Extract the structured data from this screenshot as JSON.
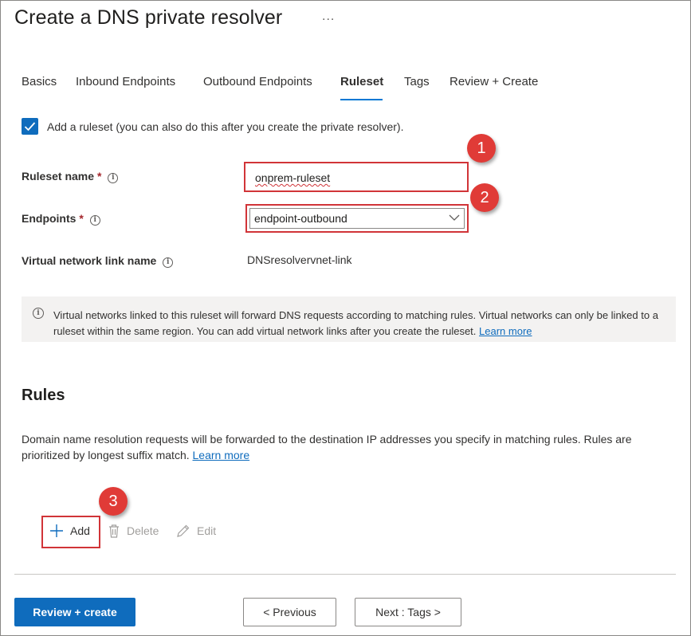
{
  "page": {
    "title": "Create a DNS private resolver",
    "more_label": "..."
  },
  "tabs": [
    {
      "label": "Basics",
      "active": false
    },
    {
      "label": "Inbound Endpoints",
      "active": false
    },
    {
      "label": "Outbound Endpoints",
      "active": false
    },
    {
      "label": "Ruleset",
      "active": true
    },
    {
      "label": "Tags",
      "active": false
    },
    {
      "label": "Review + Create",
      "active": false
    }
  ],
  "ruleset_checkbox": {
    "checked": true,
    "label": "Add a ruleset (you can also do this after you create the private resolver)."
  },
  "form": {
    "ruleset_name": {
      "label": "Ruleset name",
      "required_mark": "*",
      "value": "onprem-ruleset"
    },
    "endpoints": {
      "label": "Endpoints",
      "required_mark": "*",
      "value": "endpoint-outbound"
    },
    "vnet_link": {
      "label": "Virtual network link name",
      "value": "DNSresolvervnet-link"
    }
  },
  "info_banner": {
    "text": "Virtual networks linked to this ruleset will forward DNS requests according to matching rules. Virtual networks can only be linked to a ruleset within the same region. You can add virtual network links after you create the ruleset.",
    "link": "Learn more"
  },
  "rules": {
    "title": "Rules",
    "description": "Domain name resolution requests will be forwarded to the destination IP addresses you specify in matching rules. Rules are prioritized by longest suffix match.",
    "link": "Learn more",
    "toolbar": {
      "add_label": "Add",
      "delete_label": "Delete",
      "edit_label": "Edit"
    }
  },
  "annotations": {
    "step1": "1",
    "step2": "2",
    "step3": "3"
  },
  "footer": {
    "review_create_label": "Review + create",
    "previous_label": "< Previous",
    "next_label": "Next : Tags >"
  },
  "colors": {
    "accent": "#0f6cbd",
    "highlight_border": "#d13438",
    "step_badge": "#e03b37"
  },
  "icons": {
    "more": "ellipsis-icon",
    "checkbox": "checkmark-icon",
    "info": "info-icon",
    "dropdown": "chevron-down-icon",
    "add": "plus-icon",
    "delete": "trash-icon",
    "edit": "pencil-icon"
  }
}
